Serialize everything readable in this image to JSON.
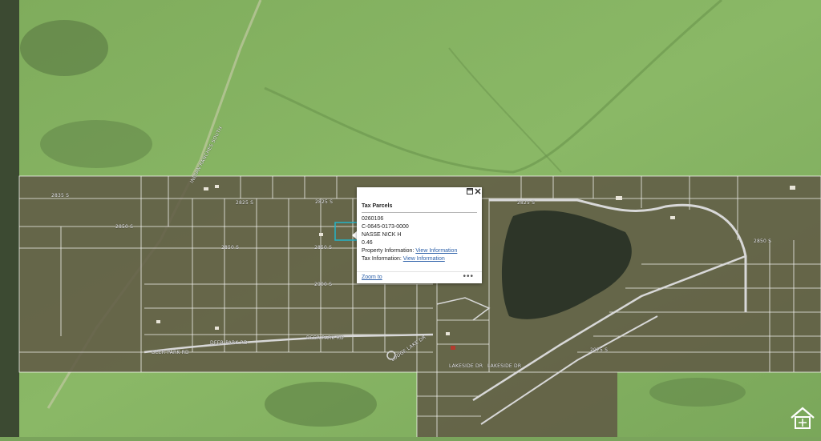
{
  "map": {
    "colors": {
      "meadow": "#86b063",
      "meadow_dark": "#6f9a4f",
      "parcel_fill": "#5e5a45",
      "parcel_line": "#ffffff",
      "lake": "#2c3428",
      "highlight": "#23b3c7"
    },
    "road_labels": [
      {
        "text": "2835 S"
      },
      {
        "text": "2825 S"
      },
      {
        "text": "2825 S"
      },
      {
        "text": "2825 S"
      },
      {
        "text": "2850 S"
      },
      {
        "text": "2850 S"
      },
      {
        "text": "2850 S"
      },
      {
        "text": "2850 S"
      },
      {
        "text": "2900 S"
      },
      {
        "text": "2975 S"
      },
      {
        "text": "DEER PARK RD"
      },
      {
        "text": "DEER PARK RD"
      },
      {
        "text": "DEER PARK RD"
      },
      {
        "text": "LAKESIDE DR"
      },
      {
        "text": "LAKESIDE DR"
      },
      {
        "text": "LODGE LAKE DR"
      },
      {
        "text": "INDIAN RANCHES SOUTH"
      }
    ]
  },
  "popup": {
    "title": "Tax Parcels",
    "parcel_number": "0260106",
    "serial": "C-0645-0173-0000",
    "owner": "NASSE NICK H",
    "acres": "0.46",
    "property_label": "Property Information:",
    "property_link": "View Information",
    "tax_label": "Tax Information:",
    "tax_link": "View Information",
    "zoom_link": "Zoom to",
    "more": "•••",
    "maximize_icon": "maximize-icon",
    "close_icon": "close-icon"
  }
}
